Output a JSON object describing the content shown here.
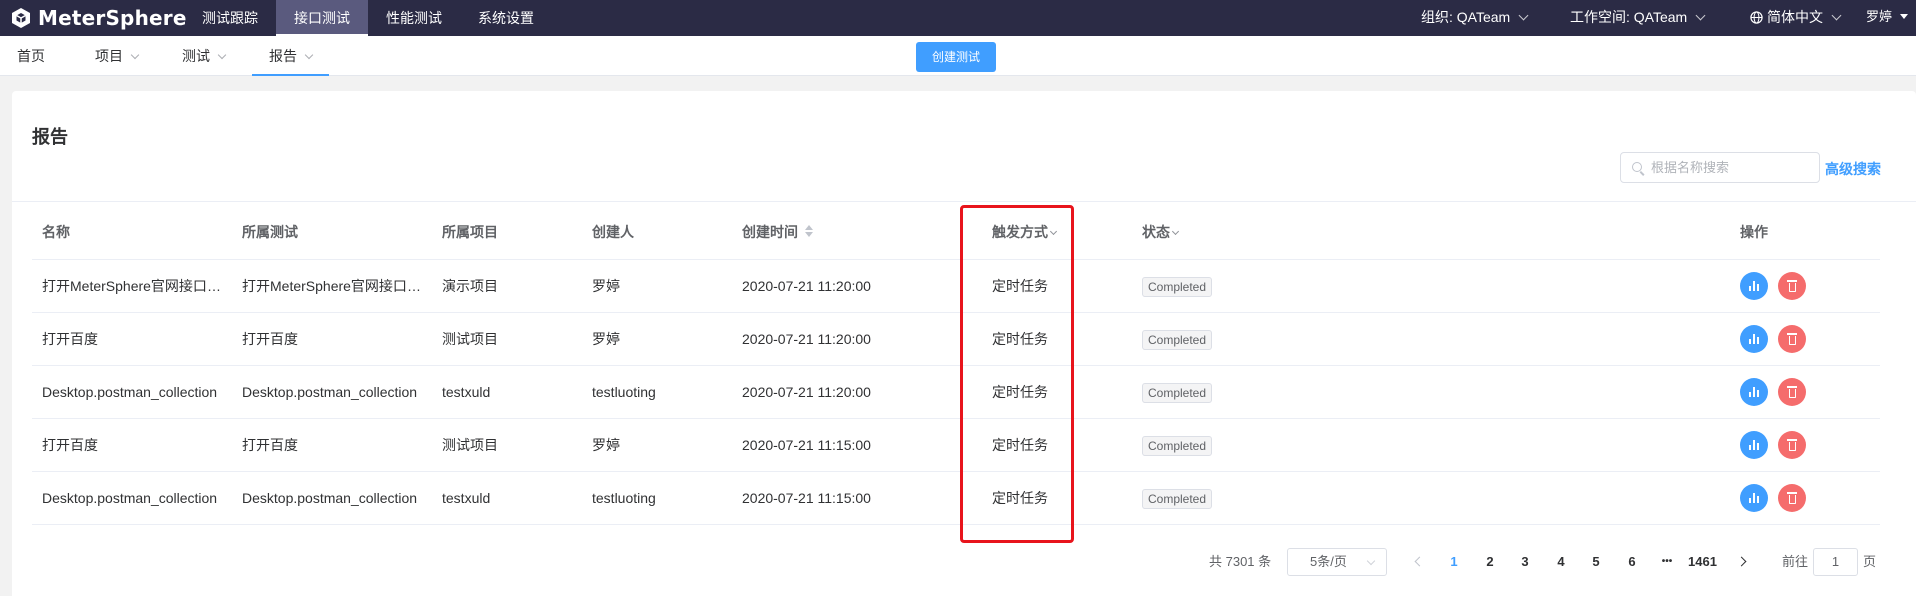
{
  "app": {
    "name": "MeterSphere"
  },
  "top_nav": {
    "items": [
      {
        "label": "测试跟踪"
      },
      {
        "label": "接口测试"
      },
      {
        "label": "性能测试"
      },
      {
        "label": "系统设置"
      }
    ],
    "active_index": 1,
    "organization": "组织: QATeam",
    "workspace": "工作空间: QATeam",
    "language": "简体中文",
    "user": "罗婷"
  },
  "sub_nav": {
    "items": [
      {
        "label": "首页"
      },
      {
        "label": "项目"
      },
      {
        "label": "测试"
      },
      {
        "label": "报告"
      }
    ],
    "active_index": 3,
    "create_button": "创建测试"
  },
  "page": {
    "title": "报告",
    "search_placeholder": "根据名称搜索",
    "advanced_search": "高级搜索"
  },
  "table": {
    "columns": [
      "名称",
      "所属测试",
      "所属项目",
      "创建人",
      "创建时间",
      "触发方式",
      "状态",
      "操作"
    ],
    "rows": [
      [
        "打开MeterSphere官网接口测试",
        "打开MeterSphere官网接口测试",
        "演示项目",
        "罗婷",
        "2020-07-21 11:20:00",
        "定时任务",
        "Completed"
      ],
      [
        "打开百度",
        "打开百度",
        "测试项目",
        "罗婷",
        "2020-07-21 11:20:00",
        "定时任务",
        "Completed"
      ],
      [
        "Desktop.postman_collection",
        "Desktop.postman_collection",
        "testxuld",
        "testluoting",
        "2020-07-21 11:20:00",
        "定时任务",
        "Completed"
      ],
      [
        "打开百度",
        "打开百度",
        "测试项目",
        "罗婷",
        "2020-07-21 11:15:00",
        "定时任务",
        "Completed"
      ],
      [
        "Desktop.postman_collection",
        "Desktop.postman_collection",
        "testxuld",
        "testluoting",
        "2020-07-21 11:15:00",
        "定时任务",
        "Completed"
      ]
    ]
  },
  "pagination": {
    "total": "共 7301 条",
    "page_size": "5条/页",
    "pages": [
      "1",
      "2",
      "3",
      "4",
      "5",
      "6"
    ],
    "ellipsis": "•••",
    "last_page": "1461",
    "current": "1",
    "goto_label": "前往",
    "goto_value": "1",
    "goto_suffix": "页"
  },
  "colors": {
    "topbar": "#2b2b45",
    "primary": "#409eff",
    "danger": "#f56c6c",
    "highlight": "#e8141c"
  }
}
